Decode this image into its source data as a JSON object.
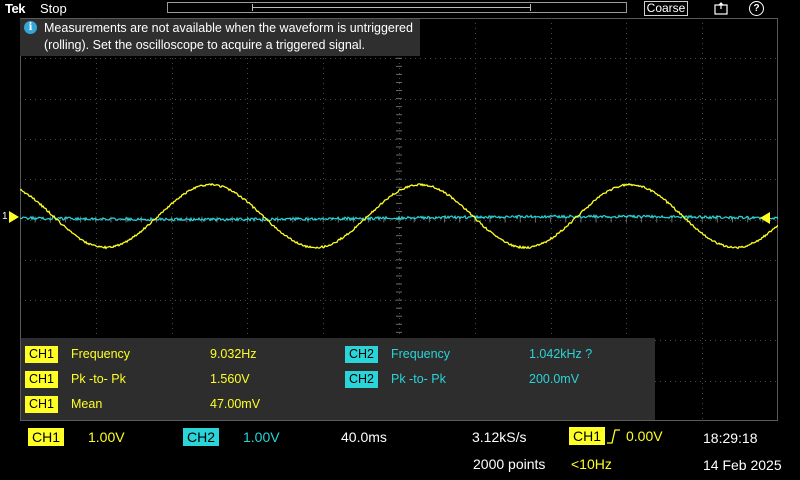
{
  "topbar": {
    "brand": "Tek",
    "run_state": "Stop",
    "coarse_label": "Coarse",
    "help_label": "?"
  },
  "info_banner": {
    "text": "Measurements are not available when the waveform is untriggered (rolling). Set the oscilloscope to acquire a triggered signal.",
    "icon": "info-icon"
  },
  "markers": {
    "ch1_level": "1"
  },
  "measurements": {
    "left": [
      {
        "channel": "CH1",
        "name": "Frequency",
        "value": "9.032Hz"
      },
      {
        "channel": "CH1",
        "name": "Pk -to- Pk",
        "value": "1.560V"
      },
      {
        "channel": "CH1",
        "name": "Mean",
        "value": "47.00mV"
      }
    ],
    "right": [
      {
        "channel": "CH2",
        "name": "Frequency",
        "value": "1.042kHz  ?"
      },
      {
        "channel": "CH2",
        "name": "Pk -to- Pk",
        "value": "200.0mV"
      }
    ]
  },
  "status": {
    "ch1_label": "CH1",
    "ch1_scale": "1.00V",
    "ch2_label": "CH2",
    "ch2_scale": "1.00V",
    "timebase": "40.0ms",
    "sample_rate": "3.12kS/s",
    "points": "2000 points",
    "trigger_source": "CH1",
    "trigger_level": "0.00V",
    "trigger_filter": "<10Hz",
    "time": "18:29:18",
    "date": "14 Feb 2025"
  },
  "colors": {
    "ch1": "#ffff26",
    "ch2": "#2ad4d8",
    "panel_bg": "#2d2d2d",
    "banner_bg": "#2f2f2f"
  },
  "waveforms": {
    "ch1": {
      "type": "sine",
      "frequency_hz": 9.032,
      "pk_to_pk_v": 1.56,
      "mean_v": 0.047
    },
    "ch2": {
      "type": "noise",
      "pk_to_pk_v": 0.2
    }
  }
}
